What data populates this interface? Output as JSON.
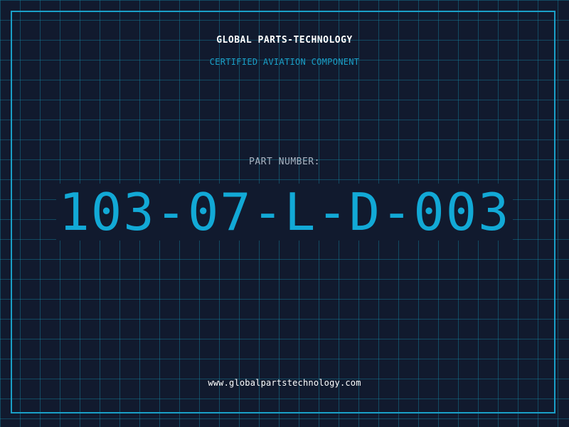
{
  "brand": {
    "name": "GLOBAL PARTS-TECHNOLOGY",
    "tagline": "CERTIFIED AVIATION COMPONENT"
  },
  "part": {
    "label": "PART NUMBER:",
    "number": "103-07-L-D-003"
  },
  "footer": {
    "website": "www.globalpartstechnology.com"
  },
  "colors": {
    "background": "#111a2e",
    "accent": "#1a9fc7",
    "grid": "#168caa",
    "text": "#ffffff",
    "muted": "#aab4c2"
  }
}
